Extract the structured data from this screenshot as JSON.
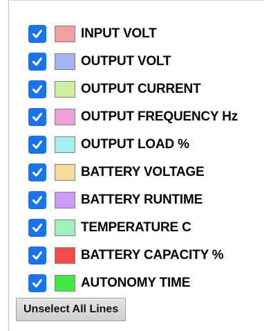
{
  "legend": {
    "items": [
      {
        "label": "INPUT VOLT",
        "color": "#f4a0a0",
        "checked": true
      },
      {
        "label": "OUTPUT VOLT",
        "color": "#a4b4f0",
        "checked": true
      },
      {
        "label": "OUTPUT CURRENT",
        "color": "#ccf0a0",
        "checked": true
      },
      {
        "label": "OUTPUT FREQUENCY Hz",
        "color": "#f0a0d8",
        "checked": true
      },
      {
        "label": "OUTPUT LOAD %",
        "color": "#a4f0f0",
        "checked": true
      },
      {
        "label": "BATTERY VOLTAGE",
        "color": "#f4dc9c",
        "checked": true
      },
      {
        "label": "BATTERY RUNTIME",
        "color": "#cc9cf4",
        "checked": true
      },
      {
        "label": "TEMPERATURE C",
        "color": "#a0f0bc",
        "checked": true
      },
      {
        "label": "BATTERY CAPACITY %",
        "color": "#f44c4c",
        "checked": true
      },
      {
        "label": "AUTONOMY TIME",
        "color": "#44e844",
        "checked": true
      }
    ]
  },
  "controls": {
    "unselect_label": "Unselect All Lines"
  },
  "colors": {
    "checkbox_blue": "#1a73e8"
  }
}
